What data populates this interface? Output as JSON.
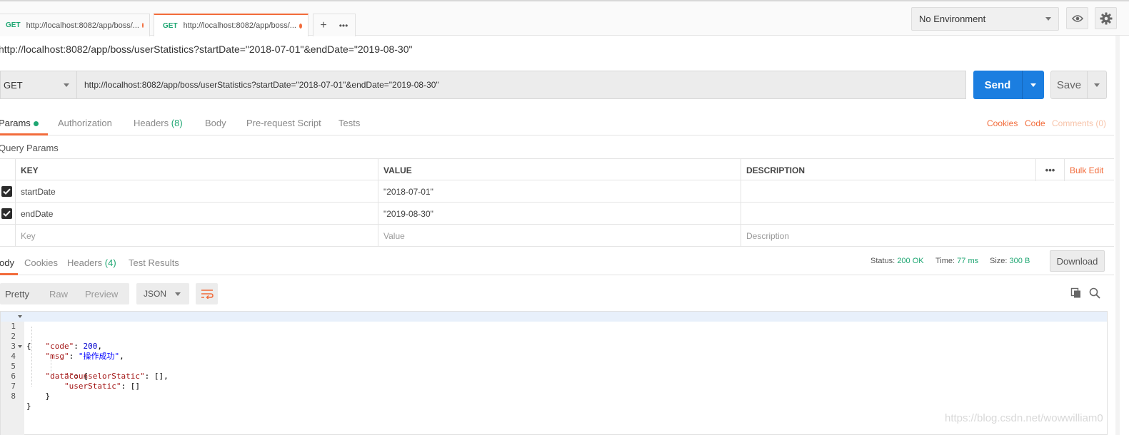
{
  "tabs": [
    {
      "method": "GET",
      "url": "http://localhost:8082/app/boss/..."
    },
    {
      "method": "GET",
      "url": "http://localhost:8082/app/boss/..."
    }
  ],
  "tab_actions": {
    "add": "+",
    "more": "•••"
  },
  "environment": {
    "label": "No Environment"
  },
  "request": {
    "title": "http://localhost:8082/app/boss/userStatistics?startDate=\"2018-07-01\"&endDate=\"2019-08-30\"",
    "method": "GET",
    "url": "http://localhost:8082/app/boss/userStatistics?startDate=\"2018-07-01\"&endDate=\"2019-08-30\"",
    "send_label": "Send",
    "save_label": "Save"
  },
  "request_tabs": {
    "params": "Params",
    "authorization": "Authorization",
    "headers": "Headers",
    "headers_count": "(8)",
    "body": "Body",
    "prerequest": "Pre-request Script",
    "tests": "Tests",
    "cookies": "Cookies",
    "code": "Code",
    "comments": "Comments (0)"
  },
  "query_params": {
    "title": "Query Params",
    "columns": {
      "key": "KEY",
      "value": "VALUE",
      "description": "DESCRIPTION"
    },
    "more": "•••",
    "bulk_edit": "Bulk Edit",
    "rows": [
      {
        "key": "startDate",
        "value": "\"2018-07-01\"",
        "description": ""
      },
      {
        "key": "endDate",
        "value": "\"2019-08-30\"",
        "description": ""
      }
    ],
    "placeholders": {
      "key": "Key",
      "value": "Value",
      "description": "Description"
    }
  },
  "response_tabs": {
    "body": "ody",
    "cookies": "Cookies",
    "headers": "Headers",
    "headers_count": "(4)",
    "test_results": "Test Results"
  },
  "response_status": {
    "status_label": "Status:",
    "status_value": "200 OK",
    "time_label": "Time:",
    "time_value": "77 ms",
    "size_label": "Size:",
    "size_value": "300 B",
    "download": "Download"
  },
  "formats": {
    "pretty": "Pretty",
    "raw": "Raw",
    "preview": "Preview",
    "json": "JSON"
  },
  "code_lines": [
    {
      "n": "1",
      "t": "{"
    },
    {
      "n": "2",
      "t": "    \"code\": 200,"
    },
    {
      "n": "3",
      "t": "    \"msg\": \"操作成功\","
    },
    {
      "n": "4",
      "t": "    \"data\": {"
    },
    {
      "n": "5",
      "t": "        \"counselorStatic\": [],"
    },
    {
      "n": "6",
      "t": "        \"userStatic\": []"
    },
    {
      "n": "7",
      "t": "    }"
    },
    {
      "n": "8",
      "t": "}"
    }
  ],
  "watermark": "https://blog.csdn.net/wowwilliam0"
}
